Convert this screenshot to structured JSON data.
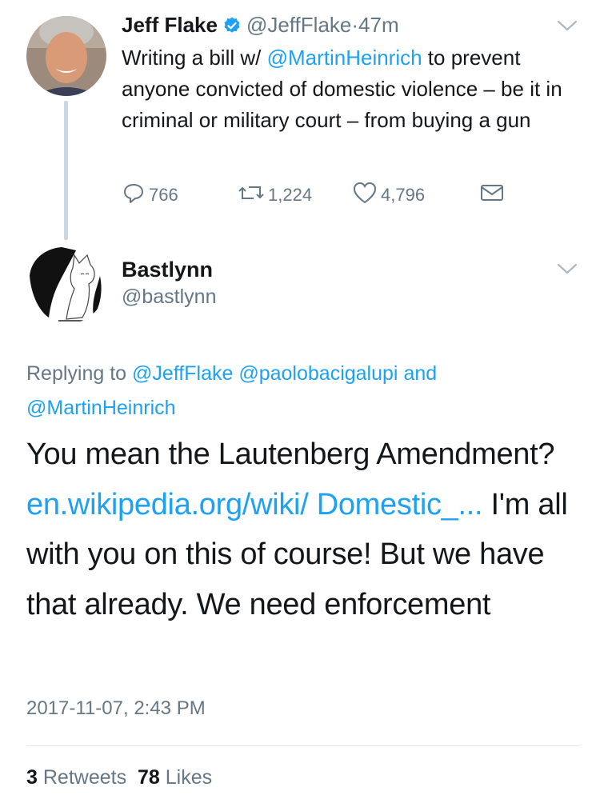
{
  "tweet": {
    "author_name": "Jeff Flake",
    "handle": "@JeffFlake",
    "separator": "·",
    "time": "47m",
    "body_prefix": "Writing a bill w/ ",
    "mention": "@MartinHeinrich",
    "body_suffix": " to prevent anyone convicted of domestic violence – be it in criminal or military court – from buying a gun",
    "replies": "766",
    "retweets": "1,224",
    "likes": "4,796",
    "icons": [
      "verified-badge-icon",
      "chevron-down-icon",
      "reply-icon",
      "retweet-icon",
      "like-icon",
      "direct-message-icon"
    ]
  },
  "reply": {
    "author_name": "Bastlynn",
    "handle": "@bastlynn",
    "replying_prefix": "Replying to ",
    "replying_to_1": "@JeffFlake",
    "replying_to_2": "@paolobacigalupi",
    "replying_and": "and",
    "replying_to_3": "@MartinHeinrich",
    "body_start": "You mean the Lautenberg Amendment? ",
    "link_text": "en.wikipedia.org/wiki/ Domestic_...",
    "body_end": " I'm all with you on this of course! But we have that already. We need enforcement",
    "timestamp": "2017-11-07, 2:43 PM",
    "retweet_count": "3",
    "retweet_label": "Retweets",
    "like_count": "78",
    "like_label": "Likes"
  },
  "colors": {
    "link": "#1da1f2",
    "muted": "#657786",
    "text": "#14171a",
    "thread_line": "#ccd6dd"
  }
}
